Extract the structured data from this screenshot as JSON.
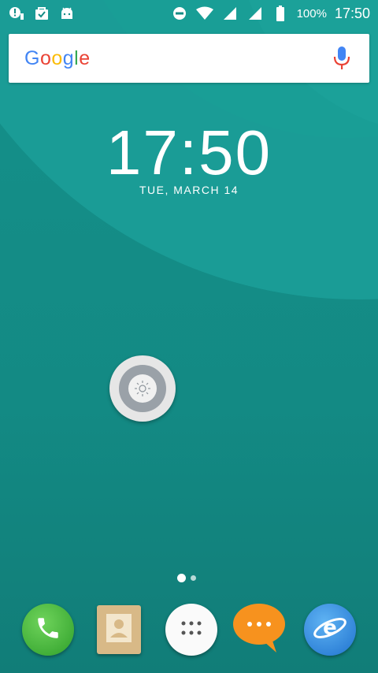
{
  "status_bar": {
    "icons_left": [
      "alert-icon",
      "shopping-bag-check-icon",
      "android-icon"
    ],
    "icons_right": [
      "do-not-disturb-icon",
      "wifi-icon",
      "signal-icon-1",
      "signal-icon-2",
      "battery-icon"
    ],
    "battery_percent": "100%",
    "time": "17:50"
  },
  "search": {
    "logo_letters": [
      "G",
      "o",
      "o",
      "g",
      "l",
      "e"
    ],
    "logo_colors": [
      "#4285F4",
      "#EA4335",
      "#FBBC05",
      "#4285F4",
      "#34A853",
      "#EA4335"
    ],
    "mic_icon": "microphone-icon"
  },
  "clock": {
    "time": "17:50",
    "date": "TUE, MARCH 14"
  },
  "floating_button": {
    "icon": "brightness-icon"
  },
  "pager": {
    "pages": 2,
    "active_index": 0
  },
  "dock": {
    "apps": [
      {
        "name": "phone",
        "icon": "phone-icon"
      },
      {
        "name": "contacts",
        "icon": "contacts-icon"
      },
      {
        "name": "app-drawer",
        "icon": "grid-icon"
      },
      {
        "name": "messages",
        "icon": "chat-bubble-icon"
      },
      {
        "name": "browser",
        "icon": "browser-e-icon"
      }
    ]
  },
  "colors": {
    "wallpaper": "#148c86",
    "accent": "#1aa098"
  }
}
